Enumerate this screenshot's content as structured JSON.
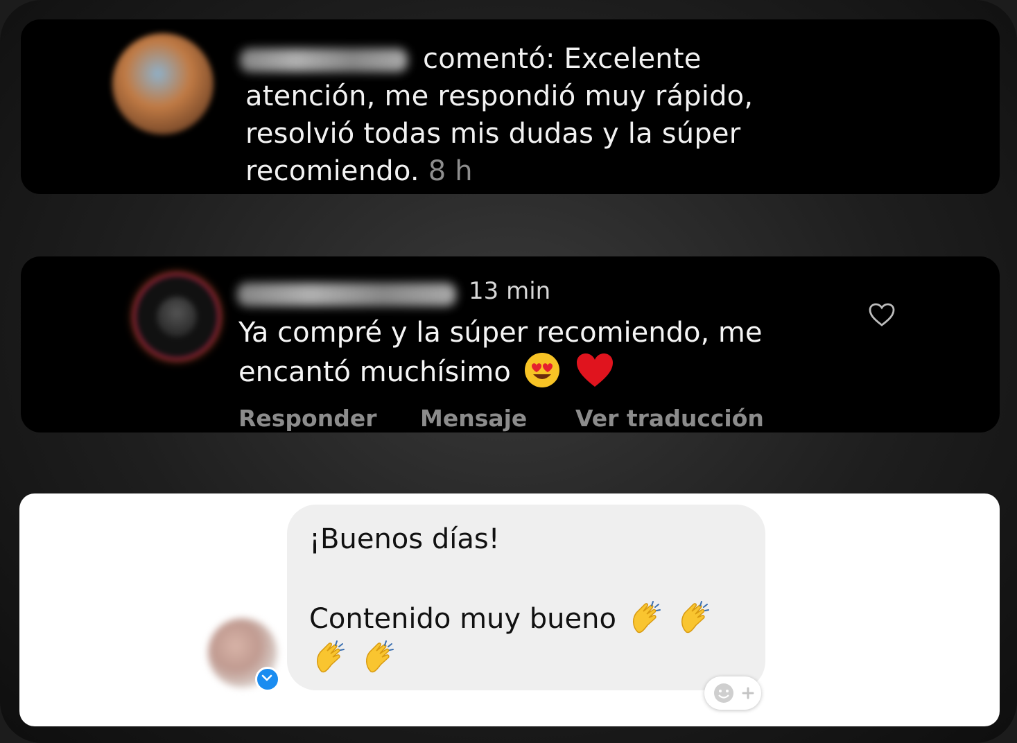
{
  "comment1": {
    "action_text": "comentó: Excelente",
    "body_lines": [
      "atención, me respondió muy rápido,",
      "resolvió todas mis dudas y la súper",
      "recomiendo."
    ],
    "time": "8 h"
  },
  "comment2": {
    "time": "13 min",
    "line1": "Ya compré y la súper recomiendo, me",
    "line2": "encantó muchísimo",
    "emojis": [
      "heart-eyes-emoji",
      "red-heart-emoji"
    ],
    "actions": {
      "reply": "Responder",
      "message": "Mensaje",
      "translate": "Ver traducción"
    }
  },
  "message": {
    "greeting": "¡Buenos días!",
    "content": "Contenido muy bueno",
    "clap_count": 4
  },
  "colors": {
    "dark_card": "#000000",
    "muted": "#8e8e8e",
    "bubble": "#efefef",
    "verified": "#1a8cf0"
  }
}
